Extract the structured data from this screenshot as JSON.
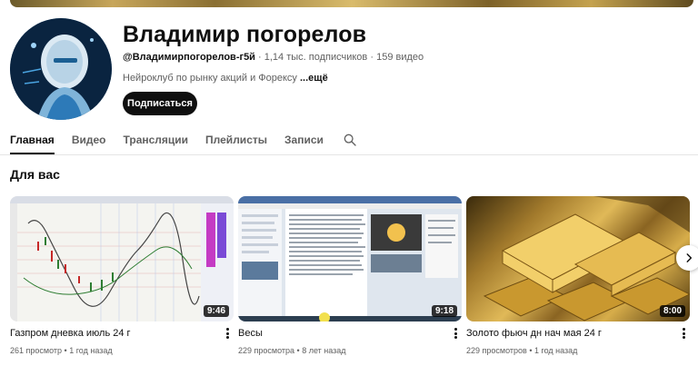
{
  "channel": {
    "name": "Владимир погорелов",
    "handle": "@Владимирпогорелов-г5й",
    "subscribers": "1,14 тыс. подписчиков",
    "videos_count": "159 видео",
    "separator": "·",
    "description": "Нейроклуб по рынку акций и Форексу",
    "more_label": "...ещё",
    "subscribe_label": "Подписаться"
  },
  "tabs": [
    {
      "label": "Главная",
      "active": true
    },
    {
      "label": "Видео",
      "active": false
    },
    {
      "label": "Трансляции",
      "active": false
    },
    {
      "label": "Плейлисты",
      "active": false
    },
    {
      "label": "Записи",
      "active": false
    }
  ],
  "section": {
    "title": "Для вас"
  },
  "videos": [
    {
      "title": "Газпром дневка июль 24 г",
      "views": "261 просмотр",
      "age": "1 год назад",
      "duration": "9:46",
      "separator": "•"
    },
    {
      "title": "Весы",
      "views": "229 просмотра",
      "age": "8 лет назад",
      "duration": "9:18",
      "separator": "•"
    },
    {
      "title": "Золото фьюч дн нач мая 24 г",
      "views": "229 просмотров",
      "age": "1 год назад",
      "duration": "8:00",
      "separator": "•"
    }
  ],
  "icons": {
    "search": "search-icon",
    "kebab": "more-vert-icon",
    "next": "chevron-right-icon"
  }
}
